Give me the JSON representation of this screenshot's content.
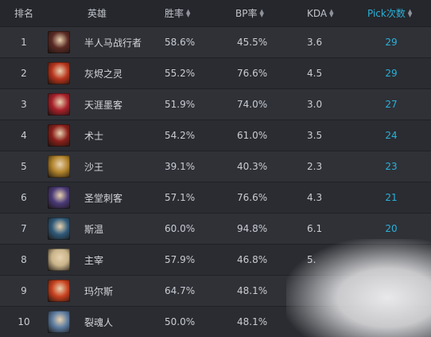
{
  "header": {
    "rank": "排名",
    "hero": "英雄",
    "win_rate": "胜率",
    "bp_rate": "BP率",
    "kda": "KDA",
    "pick_count": "Pick次数"
  },
  "rows": [
    {
      "rank": "1",
      "hero": "半人马战行者",
      "win": "58.6%",
      "bp": "45.5%",
      "kda": "3.6",
      "pick": "29",
      "avatar": "#5a2a24"
    },
    {
      "rank": "2",
      "hero": "灰烬之灵",
      "win": "55.2%",
      "bp": "76.6%",
      "kda": "4.5",
      "pick": "29",
      "avatar": "#b8341c"
    },
    {
      "rank": "3",
      "hero": "天涯墨客",
      "win": "51.9%",
      "bp": "74.0%",
      "kda": "3.0",
      "pick": "27",
      "avatar": "#a8202a"
    },
    {
      "rank": "4",
      "hero": "术士",
      "win": "54.2%",
      "bp": "61.0%",
      "kda": "3.5",
      "pick": "24",
      "avatar": "#8a1f1a"
    },
    {
      "rank": "5",
      "hero": "沙王",
      "win": "39.1%",
      "bp": "40.3%",
      "kda": "2.3",
      "pick": "23",
      "avatar": "#b0822a"
    },
    {
      "rank": "6",
      "hero": "圣堂刺客",
      "win": "57.1%",
      "bp": "76.6%",
      "kda": "4.3",
      "pick": "21",
      "avatar": "#4a3a78"
    },
    {
      "rank": "7",
      "hero": "斯温",
      "win": "60.0%",
      "bp": "94.8%",
      "kda": "6.1",
      "pick": "20",
      "avatar": "#2f5a7a"
    },
    {
      "rank": "8",
      "hero": "主宰",
      "win": "57.9%",
      "bp": "46.8%",
      "kda": "5.",
      "pick": "",
      "avatar": "#c9b48a"
    },
    {
      "rank": "9",
      "hero": "玛尔斯",
      "win": "64.7%",
      "bp": "48.1%",
      "kda": "",
      "pick": "",
      "avatar": "#c8401e"
    },
    {
      "rank": "10",
      "hero": "裂魂人",
      "win": "50.0%",
      "bp": "48.1%",
      "kda": "",
      "pick": "",
      "avatar": "#5a7aa0"
    }
  ]
}
